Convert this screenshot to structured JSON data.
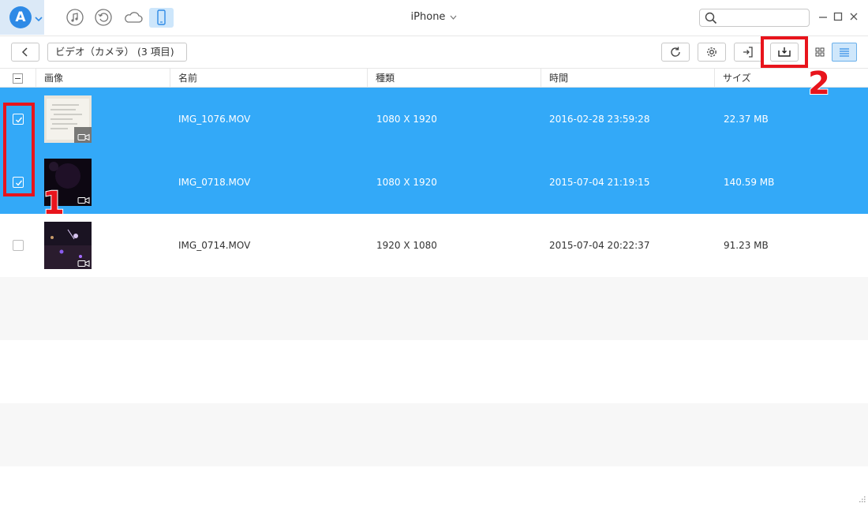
{
  "window": {
    "device_name": "iPhone",
    "logo_letter": "A"
  },
  "icons": {
    "music": "music-note-icon",
    "restore": "history-icon",
    "cloud": "cloud-icon",
    "phone": "phone-icon",
    "search": "search-icon",
    "minimize": "minimize-icon",
    "maximize": "maximize-icon",
    "close": "close-icon"
  },
  "toolbar": {
    "category_label": "ビデオ（カメラ） (3 項目)",
    "refresh": "refresh-icon",
    "settings": "gear-icon",
    "import": "import-to-device-icon",
    "export": "export-to-computer-icon",
    "grid_view": "grid-view-icon",
    "list_view": "list-view-icon"
  },
  "columns": [
    "画像",
    "名前",
    "種類",
    "時間",
    "サイズ"
  ],
  "rows": [
    {
      "name": "IMG_1076.MOV",
      "type": "1080 X 1920",
      "time": "2016-02-28 23:59:28",
      "size": "22.37 MB",
      "selected": true
    },
    {
      "name": "IMG_0718.MOV",
      "type": "1080 X 1920",
      "time": "2015-07-04 21:19:15",
      "size": "140.59 MB",
      "selected": true
    },
    {
      "name": "IMG_0714.MOV",
      "type": "1920 X 1080",
      "time": "2015-07-04 20:22:37",
      "size": "91.23 MB",
      "selected": false
    }
  ],
  "annotations": {
    "step1": "1",
    "step2": "2"
  },
  "colors": {
    "selection": "#33a9f8",
    "annotation": "#e8141c",
    "accent": "#2e8ae6"
  }
}
